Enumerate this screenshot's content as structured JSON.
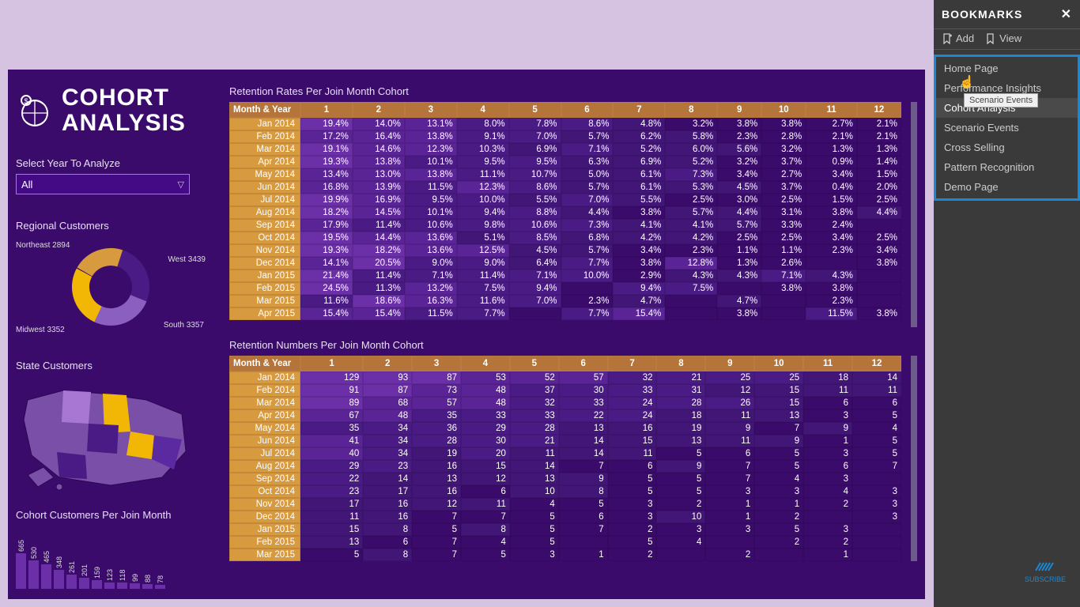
{
  "panel": {
    "title": "BOOKMARKS",
    "add": "Add",
    "view": "View",
    "items": [
      "Home Page",
      "Performance Insights",
      "Cohort Analysis",
      "Scenario Events",
      "Cross Selling",
      "Pattern Recognition",
      "Demo Page"
    ],
    "active_index": 2,
    "hover_index": 3,
    "tooltip": "Scenario Events"
  },
  "report": {
    "title_line1": "COHORT",
    "title_line2": "ANALYSIS",
    "select_label": "Select Year To Analyze",
    "select_value": "All",
    "regional": {
      "title": "Regional Customers",
      "slices": [
        {
          "label": "Northeast 2894",
          "color": "#d89a3f"
        },
        {
          "label": "West 3439",
          "color": "#4a1b85"
        },
        {
          "label": "South 3357",
          "color": "#8b5fbf"
        },
        {
          "label": "Midwest 3352",
          "color": "#f2b705"
        }
      ]
    },
    "state": {
      "title": "State Customers"
    },
    "cohort_bars": {
      "title": "Cohort Customers Per Join Month",
      "labels": [
        "665",
        "530",
        "465",
        "348",
        "261",
        "201",
        "159",
        "123",
        "118",
        "99",
        "88",
        "78"
      ],
      "values": [
        665,
        530,
        465,
        348,
        261,
        201,
        159,
        123,
        118,
        99,
        88,
        78
      ]
    },
    "rates": {
      "title": "Retention Rates Per Join Month Cohort",
      "header0": "Month & Year",
      "cols": [
        "1",
        "2",
        "3",
        "4",
        "5",
        "6",
        "7",
        "8",
        "9",
        "10",
        "11",
        "12"
      ],
      "rows": [
        {
          "m": "Jan 2014",
          "v": [
            "19.4%",
            "14.0%",
            "13.1%",
            "8.0%",
            "7.8%",
            "8.6%",
            "4.8%",
            "3.2%",
            "3.8%",
            "3.8%",
            "2.7%",
            "2.1%"
          ]
        },
        {
          "m": "Feb 2014",
          "v": [
            "17.2%",
            "16.4%",
            "13.8%",
            "9.1%",
            "7.0%",
            "5.7%",
            "6.2%",
            "5.8%",
            "2.3%",
            "2.8%",
            "2.1%",
            "2.1%"
          ]
        },
        {
          "m": "Mar 2014",
          "v": [
            "19.1%",
            "14.6%",
            "12.3%",
            "10.3%",
            "6.9%",
            "7.1%",
            "5.2%",
            "6.0%",
            "5.6%",
            "3.2%",
            "1.3%",
            "1.3%"
          ]
        },
        {
          "m": "Apr 2014",
          "v": [
            "19.3%",
            "13.8%",
            "10.1%",
            "9.5%",
            "9.5%",
            "6.3%",
            "6.9%",
            "5.2%",
            "3.2%",
            "3.7%",
            "0.9%",
            "1.4%"
          ]
        },
        {
          "m": "May 2014",
          "v": [
            "13.4%",
            "13.0%",
            "13.8%",
            "11.1%",
            "10.7%",
            "5.0%",
            "6.1%",
            "7.3%",
            "3.4%",
            "2.7%",
            "3.4%",
            "1.5%"
          ]
        },
        {
          "m": "Jun 2014",
          "v": [
            "16.8%",
            "13.9%",
            "11.5%",
            "12.3%",
            "8.6%",
            "5.7%",
            "6.1%",
            "5.3%",
            "4.5%",
            "3.7%",
            "0.4%",
            "2.0%"
          ]
        },
        {
          "m": "Jul 2014",
          "v": [
            "19.9%",
            "16.9%",
            "9.5%",
            "10.0%",
            "5.5%",
            "7.0%",
            "5.5%",
            "2.5%",
            "3.0%",
            "2.5%",
            "1.5%",
            "2.5%"
          ]
        },
        {
          "m": "Aug 2014",
          "v": [
            "18.2%",
            "14.5%",
            "10.1%",
            "9.4%",
            "8.8%",
            "4.4%",
            "3.8%",
            "5.7%",
            "4.4%",
            "3.1%",
            "3.8%",
            "4.4%"
          ]
        },
        {
          "m": "Sep 2014",
          "v": [
            "17.9%",
            "11.4%",
            "10.6%",
            "9.8%",
            "10.6%",
            "7.3%",
            "4.1%",
            "4.1%",
            "5.7%",
            "3.3%",
            "2.4%",
            ""
          ]
        },
        {
          "m": "Oct 2014",
          "v": [
            "19.5%",
            "14.4%",
            "13.6%",
            "5.1%",
            "8.5%",
            "6.8%",
            "4.2%",
            "4.2%",
            "2.5%",
            "2.5%",
            "3.4%",
            "2.5%"
          ]
        },
        {
          "m": "Nov 2014",
          "v": [
            "19.3%",
            "18.2%",
            "13.6%",
            "12.5%",
            "4.5%",
            "5.7%",
            "3.4%",
            "2.3%",
            "1.1%",
            "1.1%",
            "2.3%",
            "3.4%"
          ]
        },
        {
          "m": "Dec 2014",
          "v": [
            "14.1%",
            "20.5%",
            "9.0%",
            "9.0%",
            "6.4%",
            "7.7%",
            "3.8%",
            "12.8%",
            "1.3%",
            "2.6%",
            "",
            "3.8%"
          ]
        },
        {
          "m": "Jan 2015",
          "v": [
            "21.4%",
            "11.4%",
            "7.1%",
            "11.4%",
            "7.1%",
            "10.0%",
            "2.9%",
            "4.3%",
            "4.3%",
            "7.1%",
            "4.3%",
            ""
          ]
        },
        {
          "m": "Feb 2015",
          "v": [
            "24.5%",
            "11.3%",
            "13.2%",
            "7.5%",
            "9.4%",
            "",
            "9.4%",
            "7.5%",
            "",
            "3.8%",
            "3.8%",
            ""
          ]
        },
        {
          "m": "Mar 2015",
          "v": [
            "11.6%",
            "18.6%",
            "16.3%",
            "11.6%",
            "7.0%",
            "2.3%",
            "4.7%",
            "",
            "4.7%",
            "",
            "2.3%",
            ""
          ]
        },
        {
          "m": "Apr 2015",
          "v": [
            "15.4%",
            "15.4%",
            "11.5%",
            "7.7%",
            "",
            "7.7%",
            "15.4%",
            "",
            "3.8%",
            "",
            "11.5%",
            "3.8%"
          ]
        }
      ]
    },
    "numbers": {
      "title": "Retention Numbers Per Join Month Cohort",
      "header0": "Month & Year",
      "cols": [
        "1",
        "2",
        "3",
        "4",
        "5",
        "6",
        "7",
        "8",
        "9",
        "10",
        "11",
        "12"
      ],
      "rows": [
        {
          "m": "Jan 2014",
          "v": [
            "129",
            "93",
            "87",
            "53",
            "52",
            "57",
            "32",
            "21",
            "25",
            "25",
            "18",
            "14"
          ]
        },
        {
          "m": "Feb 2014",
          "v": [
            "91",
            "87",
            "73",
            "48",
            "37",
            "30",
            "33",
            "31",
            "12",
            "15",
            "11",
            "11"
          ]
        },
        {
          "m": "Mar 2014",
          "v": [
            "89",
            "68",
            "57",
            "48",
            "32",
            "33",
            "24",
            "28",
            "26",
            "15",
            "6",
            "6"
          ]
        },
        {
          "m": "Apr 2014",
          "v": [
            "67",
            "48",
            "35",
            "33",
            "33",
            "22",
            "24",
            "18",
            "11",
            "13",
            "3",
            "5"
          ]
        },
        {
          "m": "May 2014",
          "v": [
            "35",
            "34",
            "36",
            "29",
            "28",
            "13",
            "16",
            "19",
            "9",
            "7",
            "9",
            "4"
          ]
        },
        {
          "m": "Jun 2014",
          "v": [
            "41",
            "34",
            "28",
            "30",
            "21",
            "14",
            "15",
            "13",
            "11",
            "9",
            "1",
            "5"
          ]
        },
        {
          "m": "Jul 2014",
          "v": [
            "40",
            "34",
            "19",
            "20",
            "11",
            "14",
            "11",
            "5",
            "6",
            "5",
            "3",
            "5"
          ]
        },
        {
          "m": "Aug 2014",
          "v": [
            "29",
            "23",
            "16",
            "15",
            "14",
            "7",
            "6",
            "9",
            "7",
            "5",
            "6",
            "7"
          ]
        },
        {
          "m": "Sep 2014",
          "v": [
            "22",
            "14",
            "13",
            "12",
            "13",
            "9",
            "5",
            "5",
            "7",
            "4",
            "3",
            ""
          ]
        },
        {
          "m": "Oct 2014",
          "v": [
            "23",
            "17",
            "16",
            "6",
            "10",
            "8",
            "5",
            "5",
            "3",
            "3",
            "4",
            "3"
          ]
        },
        {
          "m": "Nov 2014",
          "v": [
            "17",
            "16",
            "12",
            "11",
            "4",
            "5",
            "3",
            "2",
            "1",
            "1",
            "2",
            "3"
          ]
        },
        {
          "m": "Dec 2014",
          "v": [
            "11",
            "16",
            "7",
            "7",
            "5",
            "6",
            "3",
            "10",
            "1",
            "2",
            "",
            "3"
          ]
        },
        {
          "m": "Jan 2015",
          "v": [
            "15",
            "8",
            "5",
            "8",
            "5",
            "7",
            "2",
            "3",
            "3",
            "5",
            "3",
            ""
          ]
        },
        {
          "m": "Feb 2015",
          "v": [
            "13",
            "6",
            "7",
            "4",
            "5",
            "",
            "5",
            "4",
            "",
            "2",
            "2",
            ""
          ]
        },
        {
          "m": "Mar 2015",
          "v": [
            "5",
            "8",
            "7",
            "5",
            "3",
            "1",
            "2",
            "",
            "2",
            "",
            "1",
            ""
          ]
        }
      ]
    }
  },
  "subscribe": "SUBSCRIBE",
  "chart_data": [
    {
      "type": "pie",
      "title": "Regional Customers",
      "series": [
        {
          "name": "customers",
          "values": [
            2894,
            3439,
            3357,
            3352
          ]
        }
      ],
      "categories": [
        "Northeast",
        "West",
        "South",
        "Midwest"
      ]
    },
    {
      "type": "bar",
      "title": "Cohort Customers Per Join Month",
      "categories": [
        "665",
        "530",
        "465",
        "348",
        "261",
        "201",
        "159",
        "123",
        "118",
        "99",
        "88",
        "78"
      ],
      "values": [
        665,
        530,
        465,
        348,
        261,
        201,
        159,
        123,
        118,
        99,
        88,
        78
      ],
      "xlabel": "",
      "ylabel": "",
      "ylim": [
        0,
        700
      ]
    }
  ]
}
